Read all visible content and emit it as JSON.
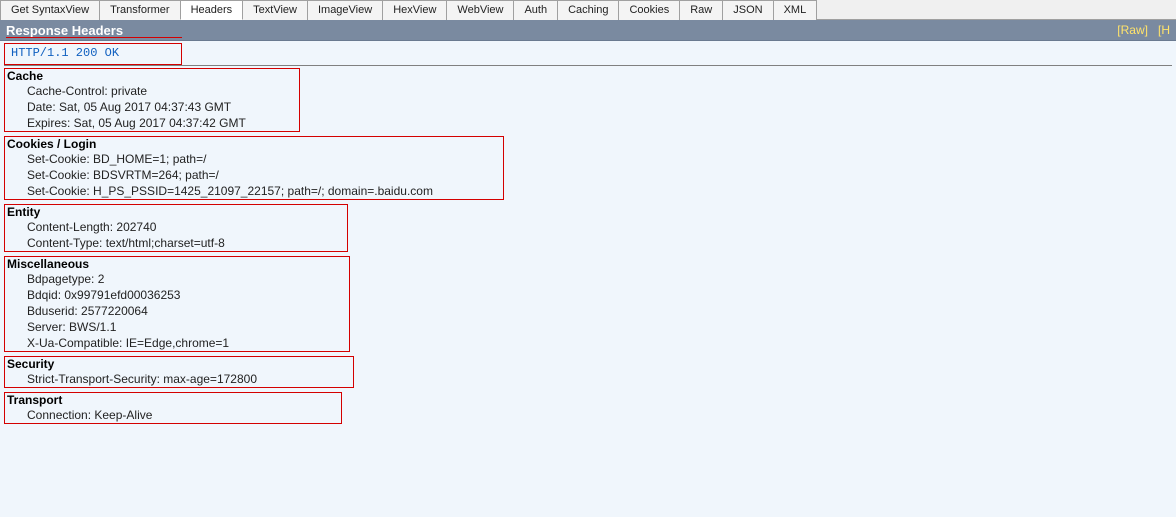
{
  "tabs": {
    "items": [
      {
        "label": "Get SyntaxView"
      },
      {
        "label": "Transformer"
      },
      {
        "label": "Headers"
      },
      {
        "label": "TextView"
      },
      {
        "label": "ImageView"
      },
      {
        "label": "HexView"
      },
      {
        "label": "WebView"
      },
      {
        "label": "Auth"
      },
      {
        "label": "Caching"
      },
      {
        "label": "Cookies"
      },
      {
        "label": "Raw"
      },
      {
        "label": "JSON"
      },
      {
        "label": "XML"
      }
    ],
    "activeIndex": 2
  },
  "sectionBar": {
    "title": "Response Headers",
    "rawLink": "[Raw]",
    "headerDefsLink": "[H"
  },
  "status": "HTTP/1.1 200 OK",
  "groups": {
    "cache": {
      "title": "Cache",
      "items": [
        "Cache-Control: private",
        "Date: Sat, 05 Aug 2017 04:37:43 GMT",
        "Expires: Sat, 05 Aug 2017 04:37:42 GMT"
      ]
    },
    "cookies": {
      "title": "Cookies / Login",
      "items": [
        "Set-Cookie: BD_HOME=1; path=/",
        "Set-Cookie: BDSVRTM=264; path=/",
        "Set-Cookie: H_PS_PSSID=1425_21097_22157; path=/; domain=.baidu.com"
      ]
    },
    "entity": {
      "title": "Entity",
      "items": [
        "Content-Length: 202740",
        "Content-Type: text/html;charset=utf-8"
      ]
    },
    "misc": {
      "title": "Miscellaneous",
      "items": [
        "Bdpagetype: 2",
        "Bdqid: 0x99791efd00036253",
        "Bduserid: 2577220064",
        "Server: BWS/1.1",
        "X-Ua-Compatible: IE=Edge,chrome=1"
      ]
    },
    "security": {
      "title": "Security",
      "items": [
        "Strict-Transport-Security: max-age=172800"
      ]
    },
    "transport": {
      "title": "Transport",
      "items": [
        "Connection: Keep-Alive"
      ]
    }
  }
}
